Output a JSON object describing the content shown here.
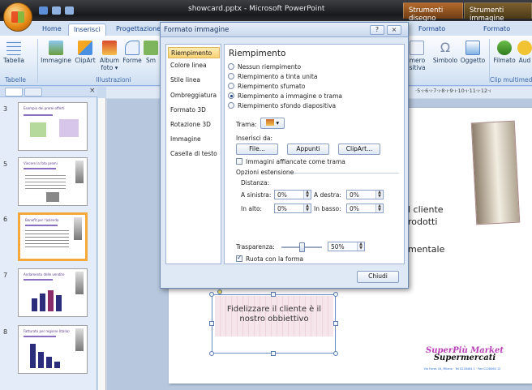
{
  "window": {
    "title": "showcard.pptx - Microsoft PowerPoint",
    "contextual_tabs": [
      "Strumenti disegno",
      "Strumenti immagine"
    ]
  },
  "ribbon": {
    "tabs": [
      "Home",
      "Inserisci",
      "Progettazione",
      "Formato",
      "Formato"
    ],
    "buttons": {
      "tabella": "Tabella",
      "immagine": "Immagine",
      "clipart": "ClipArt",
      "album": "Album foto ▾",
      "forme": "Forme",
      "smartart": "Sm",
      "numero": "umero",
      "numero2": "ositiva",
      "simbolo": "Simbolo",
      "oggetto": "Oggetto",
      "filmato": "Filmato",
      "audio": "Aud"
    },
    "groups": {
      "tabelle": "Tabelle",
      "illustrazioni": "Illustrazioni",
      "clip": "Clip multimed"
    }
  },
  "ruler": {
    "text": "·5·ı·6·ı·7·ı·8·ı·9·ı·10·ı·11·ı·12·ı"
  },
  "thumbnails": [
    {
      "num": "3",
      "title": "Esempio dei premi offerti"
    },
    {
      "num": "5",
      "title": "Vincere la foto premi"
    },
    {
      "num": "6",
      "title": "Benefit per l'azienda"
    },
    {
      "num": "7",
      "title": "Andamento delle vendite"
    },
    {
      "num": "8",
      "title": "Fatturato per regione (Italia)"
    }
  ],
  "slide": {
    "text1": "l cliente",
    "text2": "rodotti",
    "text3": "mentale",
    "box_text": "Fidelizzare il cliente è il nostro obbiettivo",
    "brand_top": "SuperPiù Market",
    "brand_bottom": "Supermercati",
    "address": "Via Forza 16, Milano · Tel 0228464 1 · Fax 0228464 12"
  },
  "dialog": {
    "title": "Formato immagine",
    "help": "?",
    "close": "⨯",
    "nav": [
      "Riempimento",
      "Colore linea",
      "Stile linea",
      "Ombreggiatura",
      "Formato 3D",
      "Rotazione 3D",
      "Immagine",
      "Casella di testo"
    ],
    "heading": "Riempimento",
    "fill_options": [
      {
        "label": "Nessun riempimento",
        "selected": false
      },
      {
        "label": "Riempimento a tinta unita",
        "selected": false
      },
      {
        "label": "Riempimento sfumato",
        "selected": false
      },
      {
        "label": "Riempimento a immagine o trama",
        "selected": true
      },
      {
        "label": "Riempimento sfondo diapositiva",
        "selected": false
      }
    ],
    "trama_label": "Trama:",
    "inserisci_da": "Inserisci da:",
    "file_btn": "File...",
    "appunti_btn": "Appunti",
    "clipart_btn": "ClipArt...",
    "affiancate_label": "Immagini affiancate come trama",
    "affiancate_checked": false,
    "opzioni_estensione": "Opzioni estensione",
    "distanza": "Distanza:",
    "sinistra_label": "A sinistra:",
    "sinistra_value": "0%",
    "destra_label": "A destra:",
    "destra_value": "0%",
    "alto_label": "In alto:",
    "alto_value": "0%",
    "basso_label": "In basso:",
    "basso_value": "0%",
    "trasparenza_label": "Trasparenza:",
    "trasparenza_value": "50%",
    "trasparenza_fraction": 0.5,
    "ruota_label": "Ruota con la forma",
    "ruota_checked": true,
    "chiudi": "Chiudi"
  }
}
